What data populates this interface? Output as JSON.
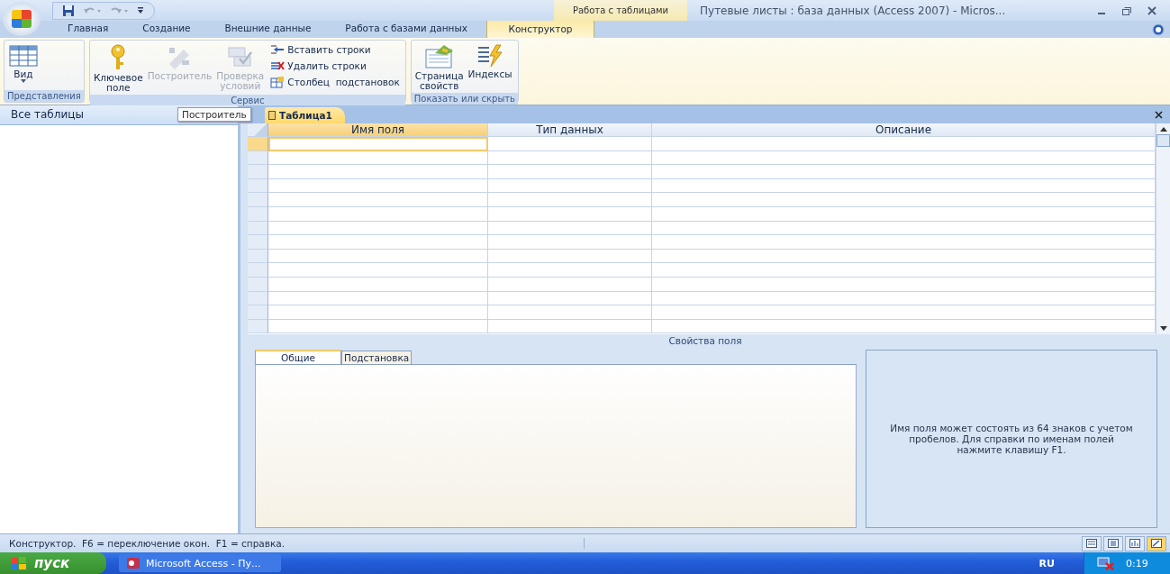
{
  "window": {
    "title": "Путевые листы : база данных (Access 2007) - Micros..."
  },
  "contextual_group": {
    "label": "Работа с таблицами"
  },
  "ribbon_tabs": [
    {
      "label": "Главная",
      "selected": false,
      "contextual": false
    },
    {
      "label": "Создание",
      "selected": false,
      "contextual": false
    },
    {
      "label": "Внешние данные",
      "selected": false,
      "contextual": false
    },
    {
      "label": "Работа с базами данных",
      "selected": false,
      "contextual": false
    },
    {
      "label": "Конструктор",
      "selected": true,
      "contextual": true
    }
  ],
  "ribbon_groups": [
    {
      "label": "Представления",
      "buttons": [
        {
          "kind": "large",
          "label": "Вид",
          "disabled": false,
          "dropdown": true
        }
      ]
    },
    {
      "label": "Сервис",
      "buttons": [
        {
          "kind": "large",
          "label": "Ключевое поле",
          "disabled": false,
          "dropdown": false
        },
        {
          "kind": "large",
          "label": "Построитель",
          "disabled": true,
          "dropdown": false
        },
        {
          "kind": "large",
          "label": "Проверка условий",
          "disabled": true,
          "dropdown": false
        },
        {
          "kind": "small",
          "label": "Вставить строки",
          "disabled": false
        },
        {
          "kind": "small",
          "label": "Удалить строки",
          "disabled": false
        },
        {
          "kind": "small",
          "label": "Столбец  подстановок",
          "disabled": false
        }
      ]
    },
    {
      "label": "Показать или скрыть",
      "buttons": [
        {
          "kind": "large",
          "label": "Страница свойств",
          "disabled": false,
          "dropdown": false
        },
        {
          "kind": "large",
          "label": "Индексы",
          "disabled": false,
          "dropdown": false
        }
      ]
    }
  ],
  "tooltip": {
    "text": "Построитель"
  },
  "nav_pane": {
    "title": "Все таблицы"
  },
  "document_tab": {
    "label": "Таблица1",
    "selected": true
  },
  "design_grid": {
    "columns": [
      {
        "label": "Имя поля",
        "selected": true
      },
      {
        "label": "Тип данных",
        "selected": false
      },
      {
        "label": "Описание",
        "selected": false
      }
    ]
  },
  "field_properties": {
    "title": "Свойства поля",
    "tabs": [
      {
        "label": "Общие",
        "selected": true
      },
      {
        "label": "Подстановка",
        "selected": false
      }
    ],
    "help": "Имя поля может состоять из 64 знаков с учетом пробелов.  Для справки по именам полей нажмите клавишу F1."
  },
  "status_bar": {
    "text": "Конструктор.  F6 = переключение окон.  F1 = справка.",
    "views": [
      {
        "selected": false
      },
      {
        "selected": false
      },
      {
        "selected": false
      },
      {
        "selected": true
      }
    ]
  },
  "taskbar": {
    "start": "пуск",
    "tasks": [
      {
        "label": "Microsoft Access - Пу...",
        "selected": false
      }
    ],
    "language": "RU",
    "clock": "0:19"
  }
}
